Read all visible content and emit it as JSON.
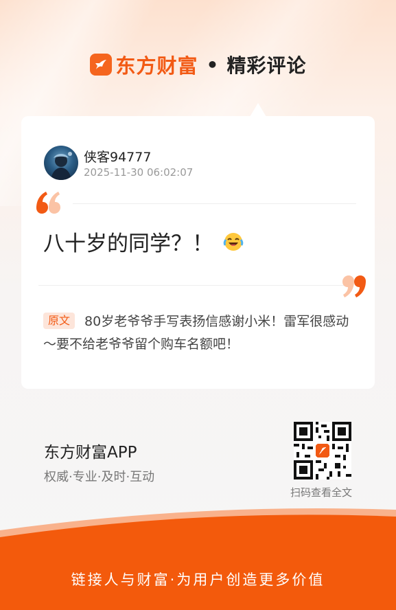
{
  "header": {
    "brand_name": "东方财富",
    "separator": "•",
    "subtitle": "精彩评论",
    "logo_icon": "eastmoney-logo-icon"
  },
  "comment_card": {
    "user": {
      "name": "侠客94777",
      "timestamp": "2025-11-30 06:02:07",
      "avatar_icon": "user-avatar"
    },
    "comment_text": "八十岁的同学？！",
    "emoji_icon": "laughing-crying-emoji-icon",
    "original": {
      "badge": "原文",
      "text": "80岁老爷爷手写表扬信感谢小米！雷军很感动～要不给老爷爷留个购车名额吧！"
    }
  },
  "app_promo": {
    "title": "东方财富APP",
    "tagline": "权威·专业·及时·互动",
    "qr_caption": "扫码查看全文"
  },
  "footer": {
    "slogan": "链接人与财富·为用户创造更多价值"
  },
  "colors": {
    "brand_orange": "#f25a14",
    "footer_orange": "#f35a0c",
    "badge_bg": "#fde5da"
  }
}
